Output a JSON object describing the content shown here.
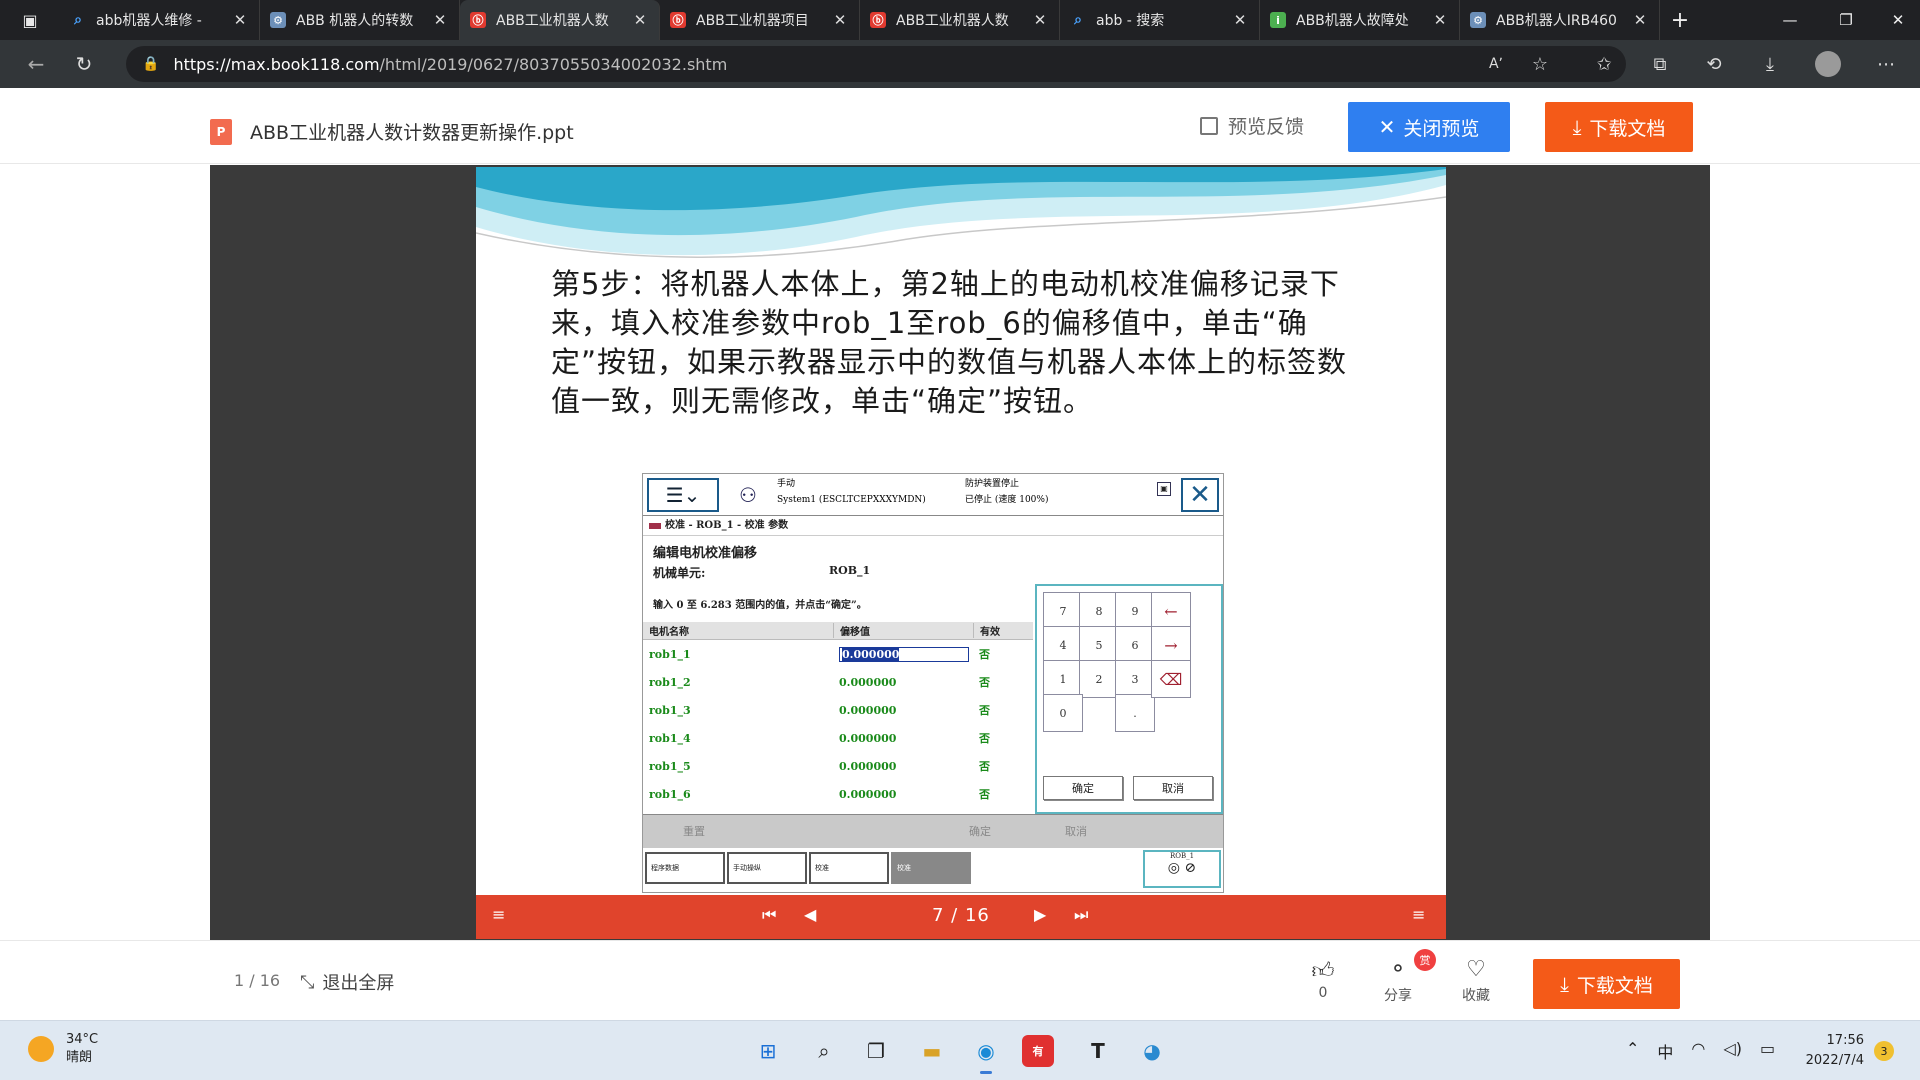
{
  "browser": {
    "tabs": [
      {
        "title": "abb机器人维修 - ",
        "icon": "search-icon"
      },
      {
        "title": "ABB 机器人的转数",
        "icon": "robot-icon"
      },
      {
        "title": "ABB工业机器人数",
        "icon": "doc-icon",
        "active": true
      },
      {
        "title": "ABB工业机器项目",
        "icon": "doc-icon"
      },
      {
        "title": "ABB工业机器人数",
        "icon": "doc-icon"
      },
      {
        "title": "abb - 搜索",
        "icon": "search-icon"
      },
      {
        "title": "ABB机器人故障处",
        "icon": "green-icon"
      },
      {
        "title": "ABB机器人IRB460",
        "icon": "robot-icon"
      }
    ],
    "url_host": "https://max.book118.com",
    "url_path": "/html/2019/0627/8037055034002032.shtm"
  },
  "header": {
    "doc_icon_letter": "P",
    "doc_title": "ABB工业机器人数计数器更新操作.ppt",
    "feedback_label": "预览反馈",
    "close_preview_label": "关闭预览",
    "download_label": "下载文档"
  },
  "slide": {
    "text": "第5步：将机器人本体上，第2轴上的电动机校准偏移记录下来，填入校准参数中rob_1至rob_6的偏移值中，单击“确定”按钮，如果示教器显示中的数值与机器人本体上的标签数值一致，则无需修改，单击“确定”按钮。",
    "pendant": {
      "status_mode": "手动",
      "status_system": "System1 (ESCLTCEPXXXYMDN)",
      "status_guard": "防护装置停止",
      "status_speed": "已停止 (速度 100%)",
      "breadcrumb": "校准 - ROB_1 - 校准 参数",
      "heading": "编辑电机校准偏移",
      "unit_label": "机械单元:",
      "unit_value": "ROB_1",
      "instruction": "输入 0 至 6.283 范围内的值，并点击“确定”。",
      "columns": [
        "电机名称",
        "偏移值",
        "有效"
      ],
      "rows": [
        {
          "name": "rob1_1",
          "value": "0.000000",
          "valid": "否"
        },
        {
          "name": "rob1_2",
          "value": "0.000000",
          "valid": "否"
        },
        {
          "name": "rob1_3",
          "value": "0.000000",
          "valid": "否"
        },
        {
          "name": "rob1_4",
          "value": "0.000000",
          "valid": "否"
        },
        {
          "name": "rob1_5",
          "value": "0.000000",
          "valid": "否"
        },
        {
          "name": "rob1_6",
          "value": "0.000000",
          "valid": "否"
        }
      ],
      "keys": [
        "7",
        "8",
        "9",
        "4",
        "5",
        "6",
        "1",
        "2",
        "3",
        "0",
        "."
      ],
      "keypad_ok": "确定",
      "keypad_cancel": "取消",
      "footer_reset": "重置",
      "footer_ok": "确定",
      "footer_cancel": "取消",
      "taskbar": [
        "程序数据",
        "手动操纵",
        "校准",
        "校准"
      ],
      "rob_label": "ROB_1"
    }
  },
  "nav": {
    "page_indicator": "7 / 16"
  },
  "bottom": {
    "page_count": "1 / 16",
    "exit_fullscreen": "退出全屏",
    "like_count": "0",
    "share_label": "分享",
    "share_badge": "赏",
    "favorite_label": "收藏",
    "download_label": "下载文档"
  },
  "taskbar": {
    "temperature": "34°C",
    "weather": "晴朗",
    "ime": "中",
    "time": "17:56",
    "date": "2022/7/4",
    "notification_count": "3"
  },
  "colors": {
    "accent_blue": "#2f7ff0",
    "accent_orange": "#f45a18",
    "slide_nav": "#e0442c"
  }
}
